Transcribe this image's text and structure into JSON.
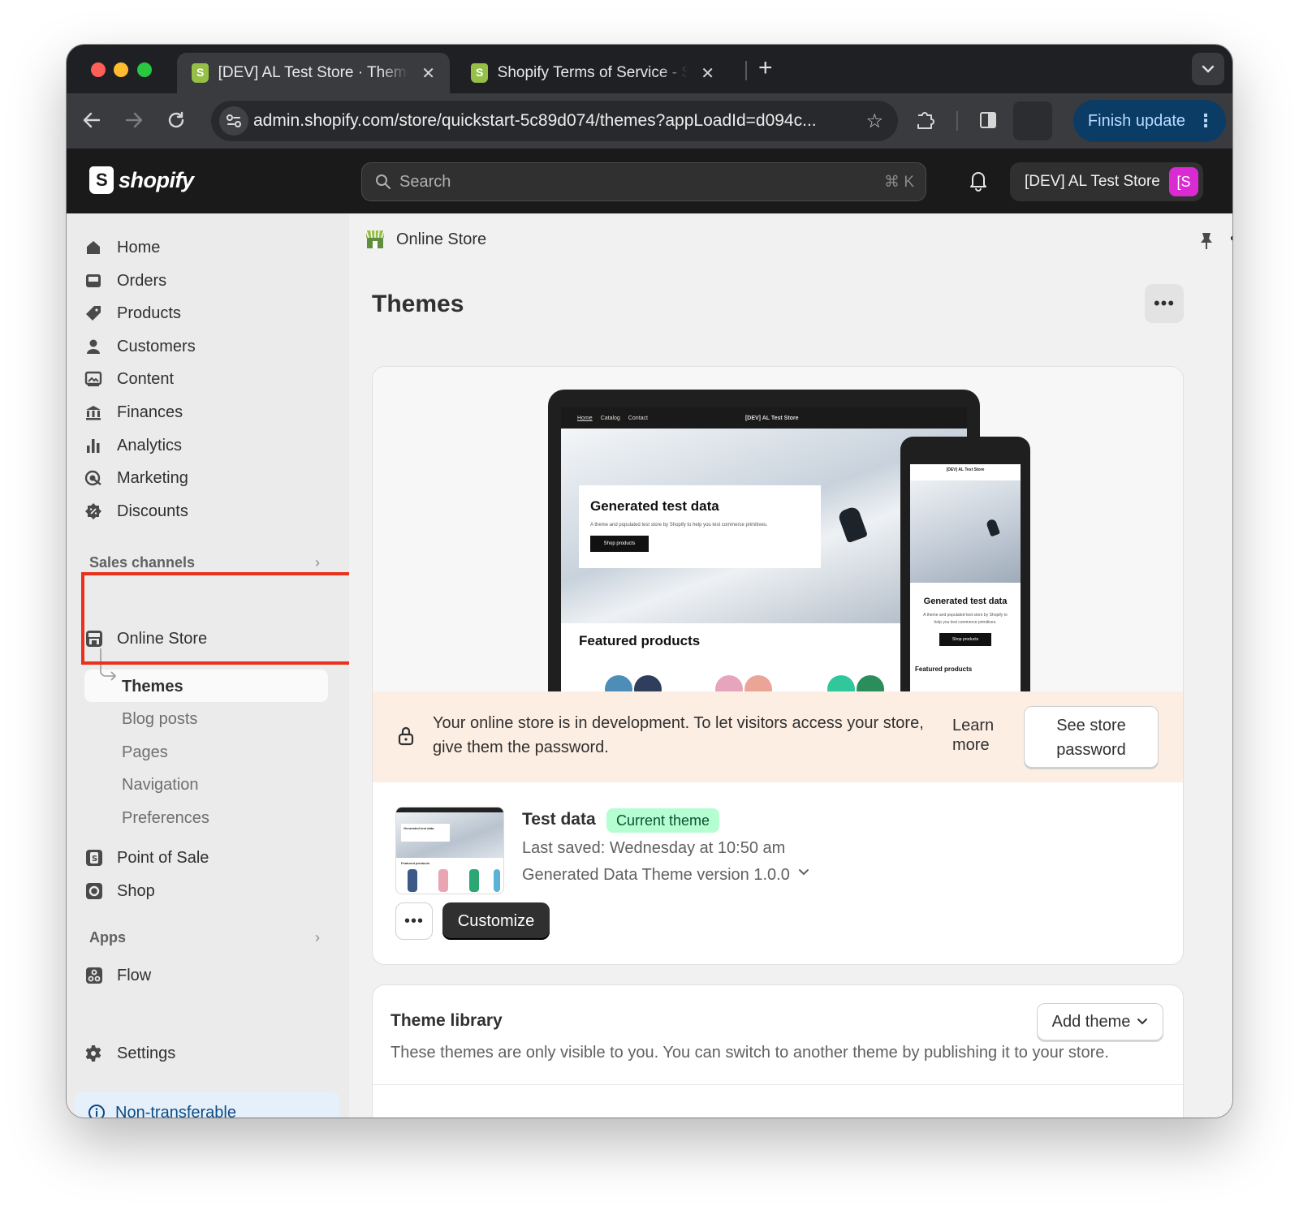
{
  "browser": {
    "tabs": [
      {
        "title": "[DEV] AL Test Store · Themes",
        "close": "✕"
      },
      {
        "title": "Shopify Terms of Service - Sh",
        "close": "✕"
      }
    ],
    "new_tab": "+",
    "url": "admin.shopify.com/store/quickstart-5c89d074/themes?appLoadId=d094c...",
    "finish_update": "Finish update"
  },
  "topbar": {
    "logo_text": "shopify",
    "search_placeholder": "Search",
    "search_shortcut": "⌘ K",
    "store_name": "[DEV] AL Test Store",
    "avatar_initial": "[S"
  },
  "sidebar": {
    "items": [
      {
        "label": "Home"
      },
      {
        "label": "Orders"
      },
      {
        "label": "Products"
      },
      {
        "label": "Customers"
      },
      {
        "label": "Content"
      },
      {
        "label": "Finances"
      },
      {
        "label": "Analytics"
      },
      {
        "label": "Marketing"
      },
      {
        "label": "Discounts"
      }
    ],
    "sales_channels_label": "Sales channels",
    "online_store": "Online Store",
    "online_store_sub": [
      "Themes",
      "Blog posts",
      "Pages",
      "Navigation",
      "Preferences"
    ],
    "other_channels": [
      "Point of Sale",
      "Shop"
    ],
    "apps_label": "Apps",
    "apps": [
      "Flow"
    ],
    "settings": "Settings",
    "non_transferable": "Non-transferable"
  },
  "main": {
    "breadcrumb": "Online Store",
    "title": "Themes",
    "preview": {
      "nav_links": [
        "Home",
        "Catalog",
        "Contact"
      ],
      "nav_store": "[DEV] AL Test Store",
      "hero_title": "Generated test data",
      "hero_text": "A theme and populated test store by Shopify to help you test commerce primitives.",
      "hero_button": "Shop products",
      "featured": "Featured products",
      "phone_store": "[DEV] AL Test Store",
      "phone_title": "Generated test data",
      "phone_text": "A theme and populated test store by Shopify to help you test commerce primitives.",
      "phone_button": "Shop products",
      "phone_featured": "Featured products"
    },
    "banner": {
      "message": "Your online store is in development. To let visitors access your store, give them the password.",
      "learn_more": "Learn more",
      "see_password": "See store password"
    },
    "current_theme": {
      "name": "Test data",
      "badge": "Current theme",
      "last_saved": "Last saved: Wednesday at 10:50 am",
      "version": "Generated Data Theme version 1.0.0",
      "thumb_title": "Generated test data",
      "thumb_featured": "Featured products",
      "customize": "Customize"
    },
    "library": {
      "title": "Theme library",
      "description": "These themes are only visible to you. You can switch to another theme by publishing it to your store.",
      "add_theme": "Add theme"
    }
  },
  "colors": {
    "highlight": "#e8321e",
    "badge_bg": "#b4fed2",
    "banner_bg": "#fdeee3",
    "finish_update_bg": "#0b3c66"
  }
}
